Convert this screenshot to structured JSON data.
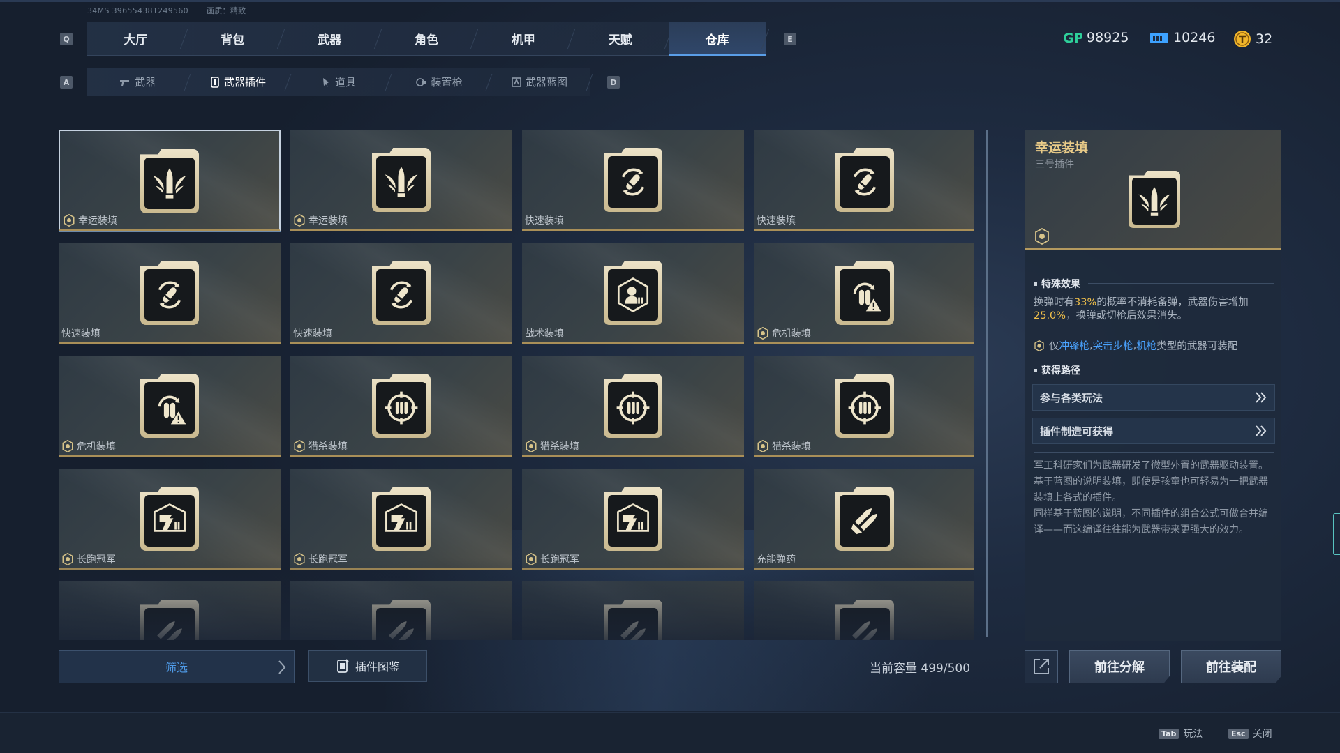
{
  "status": {
    "build_id": "34MS 396554381249560",
    "quality": "画质：精致"
  },
  "keys": {
    "prev_tab": "Q",
    "next_tab": "E",
    "prev_sub": "A",
    "next_sub": "D"
  },
  "tabs": [
    {
      "label": "大厅"
    },
    {
      "label": "背包"
    },
    {
      "label": "武器"
    },
    {
      "label": "角色"
    },
    {
      "label": "机甲"
    },
    {
      "label": "天赋"
    },
    {
      "label": "仓库",
      "active": true
    }
  ],
  "currencies": [
    {
      "icon": "gp-icon",
      "value": "98925",
      "color": "#2ecf9a"
    },
    {
      "icon": "ticket-icon",
      "value": "10246",
      "color": "#3da2ff"
    },
    {
      "icon": "coin-icon",
      "value": "32",
      "color": "#f0b52a"
    }
  ],
  "subtabs": [
    {
      "label": "武器",
      "icon": "gun-icon"
    },
    {
      "label": "武器插件",
      "icon": "chip-icon",
      "active": true
    },
    {
      "label": "道具",
      "icon": "item-icon"
    },
    {
      "label": "装置枪",
      "icon": "device-gun-icon"
    },
    {
      "label": "武器蓝图",
      "icon": "blueprint-icon"
    }
  ],
  "items": [
    {
      "name": "幸运装填",
      "icon": "lucky-reload",
      "equipped": true,
      "selected": true
    },
    {
      "name": "幸运装填",
      "icon": "lucky-reload",
      "equipped": true
    },
    {
      "name": "快速装填",
      "icon": "fast-reload",
      "equipped": false
    },
    {
      "name": "快速装填",
      "icon": "fast-reload",
      "equipped": false
    },
    {
      "name": "快速装填",
      "icon": "fast-reload",
      "equipped": false
    },
    {
      "name": "快速装填",
      "icon": "fast-reload",
      "equipped": false
    },
    {
      "name": "战术装填",
      "icon": "tactical-reload",
      "equipped": false
    },
    {
      "name": "危机装填",
      "icon": "crisis-reload",
      "equipped": true
    },
    {
      "name": "危机装填",
      "icon": "crisis-reload",
      "equipped": true
    },
    {
      "name": "猎杀装填",
      "icon": "hunt-reload",
      "equipped": true
    },
    {
      "name": "猎杀装填",
      "icon": "hunt-reload",
      "equipped": true
    },
    {
      "name": "猎杀装填",
      "icon": "hunt-reload",
      "equipped": true
    },
    {
      "name": "长跑冠军",
      "icon": "marathon",
      "equipped": true
    },
    {
      "name": "长跑冠军",
      "icon": "marathon",
      "equipped": true
    },
    {
      "name": "长跑冠军",
      "icon": "marathon",
      "equipped": true
    },
    {
      "name": "充能弹药",
      "icon": "charged-ammo",
      "equipped": false
    },
    {
      "name": "",
      "icon": "twin-bullets",
      "equipped": false
    },
    {
      "name": "",
      "icon": "twin-bullets",
      "equipped": false
    },
    {
      "name": "",
      "icon": "twin-bullets",
      "equipped": false
    },
    {
      "name": "",
      "icon": "twin-bullets",
      "equipped": false
    }
  ],
  "footer": {
    "filter_label": "筛选",
    "atlas_label": "插件图鉴",
    "capacity": "当前容量 499/500"
  },
  "detail": {
    "title": "幸运装填",
    "subtitle": "三号插件",
    "special_title": "特殊效果",
    "effect": {
      "pre": "换弹时有",
      "chance": "33%",
      "mid": "的概率不消耗备弹，武器伤害增加",
      "bonus": "25.0%",
      "post": "，换弹或切枪后效果消失。"
    },
    "restrict": {
      "pre": "仅",
      "w1": "冲锋枪",
      "s1": ",",
      "w2": "突击步枪",
      "s2": ",",
      "w3": "机枪",
      "post": "类型的武器可装配"
    },
    "obtain_title": "获得路径",
    "routes": [
      {
        "label": "参与各类玩法"
      },
      {
        "label": "插件制造可获得"
      }
    ],
    "description": "军工科研家们为武器研发了微型外置的武器驱动装置。\n基于蓝图的说明装填，即使是孩童也可轻易为一把武器装填上各式的插件。\n同样基于蓝图的说明，不同插件的组合公式可做合并编译——而这编译往往能为武器带来更强大的效力。"
  },
  "actions": {
    "dismantle": "前往分解",
    "equip": "前往装配"
  },
  "hints": [
    {
      "key": "Tab",
      "label": "玩法"
    },
    {
      "key": "Esc",
      "label": "关闭"
    }
  ]
}
